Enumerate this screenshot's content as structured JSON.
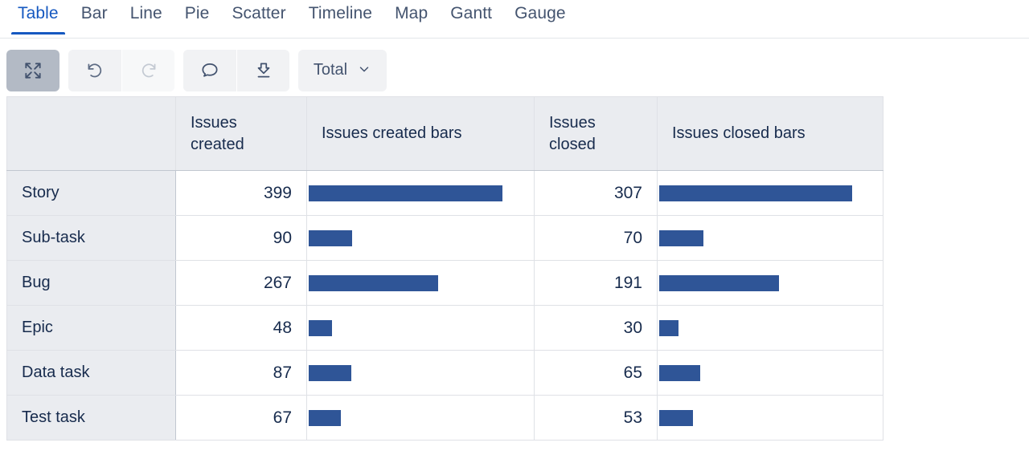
{
  "tabs": [
    {
      "label": "Table",
      "active": true
    },
    {
      "label": "Bar",
      "active": false
    },
    {
      "label": "Line",
      "active": false
    },
    {
      "label": "Pie",
      "active": false
    },
    {
      "label": "Scatter",
      "active": false
    },
    {
      "label": "Timeline",
      "active": false
    },
    {
      "label": "Map",
      "active": false
    },
    {
      "label": "Gantt",
      "active": false
    },
    {
      "label": "Gauge",
      "active": false
    }
  ],
  "toolbar": {
    "expand_icon": "expand-arrows-icon",
    "undo_icon": "undo-icon",
    "redo_icon": "redo-icon",
    "comment_icon": "comment-bubble-icon",
    "download_icon": "download-icon",
    "aggregation_label": "Total",
    "aggregation_chevron_icon": "chevron-down-icon"
  },
  "colors": {
    "accent": "#1558c0",
    "bar": "#2f5597",
    "header_bg": "#eaecf0",
    "toolbar_btn_bg": "#f1f2f4",
    "toolbar_btn_active_bg": "#b3bac5",
    "text": "#172b4d",
    "muted_text": "#44546f",
    "border": "#dfe1e6",
    "outer_border": "#c1c7d0"
  },
  "chart_data": {
    "type": "table",
    "title": "",
    "columns": [
      "",
      "Issues created",
      "Issues created bars",
      "Issues closed",
      "Issues closed bars"
    ],
    "categories": [
      "Story",
      "Sub-task",
      "Bug",
      "Epic",
      "Data task",
      "Test task"
    ],
    "series": [
      {
        "name": "Issues created",
        "values": [
          399,
          90,
          267,
          48,
          87,
          67
        ]
      },
      {
        "name": "Issues closed",
        "values": [
          307,
          70,
          191,
          30,
          65,
          53
        ]
      }
    ],
    "bar_max": {
      "issues_created": 399,
      "issues_closed": 307
    },
    "rows": [
      {
        "label": "Story",
        "created": 399,
        "created_bar_pct": 100.0,
        "closed": 307,
        "closed_bar_pct": 100.0
      },
      {
        "label": "Sub-task",
        "created": 90,
        "created_bar_pct": 22.6,
        "closed": 70,
        "closed_bar_pct": 22.8
      },
      {
        "label": "Bug",
        "created": 267,
        "created_bar_pct": 66.9,
        "closed": 191,
        "closed_bar_pct": 62.2
      },
      {
        "label": "Epic",
        "created": 48,
        "created_bar_pct": 12.0,
        "closed": 30,
        "closed_bar_pct": 9.8
      },
      {
        "label": "Data task",
        "created": 87,
        "created_bar_pct": 21.8,
        "closed": 65,
        "closed_bar_pct": 21.2
      },
      {
        "label": "Test task",
        "created": 67,
        "created_bar_pct": 16.8,
        "closed": 53,
        "closed_bar_pct": 17.3
      }
    ]
  }
}
